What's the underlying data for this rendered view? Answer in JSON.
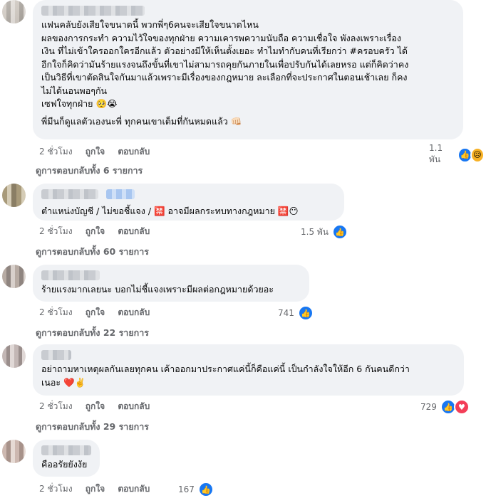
{
  "comments": [
    {
      "lines": [
        "แฟนคลับยังเสียใจขนาดนี้ พวกพี่ๆ6คนจะเสียใจขนาดไหน",
        "ผลของการกระทำ ความไว้ใจของทุกฝ่าย ความเคารพความนับถือ ความเชื่อใจ พังลงเพราะเรื่อง",
        "เงิน ที่ไม่เข้าใครออกใครอีกแล้ว ตัวอย่างมีให้เห็นตั้งเยอะ ทำไมทำกับคนที่เรียกว่า #ครอบครัว ได้",
        "อีกใจก็คิดว่ามันร้ายแรงจนถึงขั้นที่เขาไม่สามารถคุยกันภายในเพื่อปรับกันได้เลยหรอ แต่ก็คิดว่าคง",
        "เป็นวิธีที่เขาตัดสินใจกันมาแล้วเพราะมีเรื่องของกฎหมาย ละเลือกที่จะประกาศในตอนเช้าเลย ก็คง",
        "ไม่ได้นอนพอๆกัน",
        "เซฟใจทุกฝ่าย 🥺😭",
        "",
        "พี่มีนก็ดูแลตัวเองนะพี่ ทุกคนเขาเต็มที่กันหมดแล้ว 👊🏻"
      ],
      "time": "2 ชั่วโมง",
      "like": "ถูกใจ",
      "reply": "ตอบกลับ",
      "reaction_count": "1.1 พัน",
      "reaction_icons": [
        "like-icon",
        "sad-icon"
      ],
      "view_replies": "ดูการตอบกลับทั้ง 6 รายการ"
    },
    {
      "text": "ตำแหน่งบัญชี / ไม่ขอชี้แจง / 🈲 อาจมีผลกระทบทางกฎหมาย 🈲😶",
      "time": "2 ชั่วโมง",
      "like": "ถูกใจ",
      "reply": "ตอบกลับ",
      "reaction_count": "1.5 พัน",
      "reaction_icons": [
        "like-icon"
      ],
      "view_replies": "ดูการตอบกลับทั้ง 60 รายการ"
    },
    {
      "text": "ร้ายแรงมากเลยนะ บอกไม่ชี้แจงเพราะมีผลต่อกฎหมายด้วยอะ",
      "time": "2 ชั่วโมง",
      "like": "ถูกใจ",
      "reply": "ตอบกลับ",
      "reaction_count": "741",
      "reaction_icons": [
        "like-icon"
      ],
      "view_replies": "ดูการตอบกลับทั้ง 22 รายการ"
    },
    {
      "lines": [
        "อย่าถามหาเหตุผลกันเลยทุกคน เค้าออกมาประกาศแค่นี้ก็คือแค่นี้ เป็นกำลังใจให้อีก 6 กันคนดีกว่า",
        "เนอะ ❤️✌️"
      ],
      "time": "2 ชั่วโมง",
      "like": "ถูกใจ",
      "reply": "ตอบกลับ",
      "reaction_count": "729",
      "reaction_icons": [
        "like-icon",
        "love-icon"
      ],
      "view_replies": "ดูการตอบกลับทั้ง 29 รายการ"
    },
    {
      "text": "คืออรัยยังงัย",
      "time": "2 ชั่วโมง",
      "like": "ถูกใจ",
      "reply": "ตอบกลับ",
      "reaction_count": "167",
      "reaction_icons": [
        "like-icon"
      ]
    }
  ]
}
